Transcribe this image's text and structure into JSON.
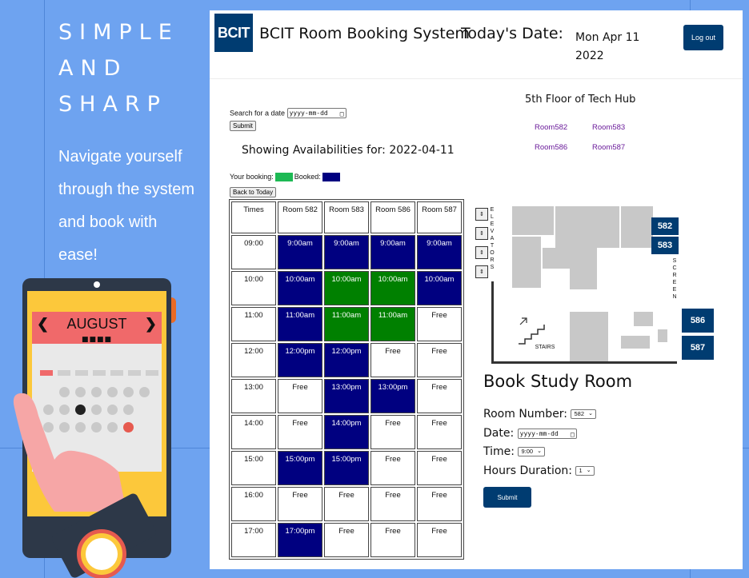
{
  "hero": {
    "title_lines": [
      "SIMPLE",
      "AND",
      "SHARP"
    ],
    "subtitle_lines": [
      "Navigate yourself",
      "through the system",
      "and book with",
      "ease!"
    ],
    "calendar_month": "AUGUST"
  },
  "header": {
    "logo": "BCIT",
    "title": "BCIT Room Booking System",
    "date_label": "Today's Date:",
    "date_line1": "Mon Apr 11",
    "date_line2": "2022",
    "logout_label": "Log out"
  },
  "search": {
    "label": "Search for a date",
    "placeholder": "yyyy-mm-dd",
    "submit_label": "Submit"
  },
  "showing": "Showing Availabilities for: 2022-04-11",
  "legend": {
    "your_booking": "Your booking:",
    "booked": "Booked:",
    "your_color": "#1db954",
    "booked_color": "#000080"
  },
  "back_to_today": "Back to Today",
  "timetable": {
    "headers": [
      "Times",
      "Room 582",
      "Room 583",
      "Room 586",
      "Room 587"
    ],
    "rows": [
      {
        "time": "09:00",
        "cells": [
          {
            "t": "9:00am",
            "s": "booked"
          },
          {
            "t": "9:00am",
            "s": "booked"
          },
          {
            "t": "9:00am",
            "s": "booked"
          },
          {
            "t": "9:00am",
            "s": "booked"
          }
        ]
      },
      {
        "time": "10:00",
        "cells": [
          {
            "t": "10:00am",
            "s": "booked"
          },
          {
            "t": "10:00am",
            "s": "mine"
          },
          {
            "t": "10:00am",
            "s": "mine"
          },
          {
            "t": "10:00am",
            "s": "booked"
          }
        ]
      },
      {
        "time": "11:00",
        "cells": [
          {
            "t": "11:00am",
            "s": "booked"
          },
          {
            "t": "11:00am",
            "s": "mine"
          },
          {
            "t": "11:00am",
            "s": "mine"
          },
          {
            "t": "Free",
            "s": "free"
          }
        ]
      },
      {
        "time": "12:00",
        "cells": [
          {
            "t": "12:00pm",
            "s": "booked"
          },
          {
            "t": "12:00pm",
            "s": "booked"
          },
          {
            "t": "Free",
            "s": "free"
          },
          {
            "t": "Free",
            "s": "free"
          }
        ]
      },
      {
        "time": "13:00",
        "cells": [
          {
            "t": "Free",
            "s": "free"
          },
          {
            "t": "13:00pm",
            "s": "booked"
          },
          {
            "t": "13:00pm",
            "s": "booked"
          },
          {
            "t": "Free",
            "s": "free"
          }
        ]
      },
      {
        "time": "14:00",
        "cells": [
          {
            "t": "Free",
            "s": "free"
          },
          {
            "t": "14:00pm",
            "s": "booked"
          },
          {
            "t": "Free",
            "s": "free"
          },
          {
            "t": "Free",
            "s": "free"
          }
        ]
      },
      {
        "time": "15:00",
        "cells": [
          {
            "t": "15:00pm",
            "s": "booked"
          },
          {
            "t": "15:00pm",
            "s": "booked"
          },
          {
            "t": "Free",
            "s": "free"
          },
          {
            "t": "Free",
            "s": "free"
          }
        ]
      },
      {
        "time": "16:00",
        "cells": [
          {
            "t": "Free",
            "s": "free"
          },
          {
            "t": "Free",
            "s": "free"
          },
          {
            "t": "Free",
            "s": "free"
          },
          {
            "t": "Free",
            "s": "free"
          }
        ]
      },
      {
        "time": "17:00",
        "cells": [
          {
            "t": "17:00pm",
            "s": "booked"
          },
          {
            "t": "Free",
            "s": "free"
          },
          {
            "t": "Free",
            "s": "free"
          },
          {
            "t": "Free",
            "s": "free"
          }
        ]
      }
    ]
  },
  "floor": {
    "title": "5th Floor of Tech Hub",
    "links": [
      "Room582",
      "Room583",
      "Room586",
      "Room587"
    ],
    "map_rooms": [
      "582",
      "583",
      "586",
      "587"
    ],
    "elevators_text": "ELEVATORS",
    "screen_text": "SCREEN",
    "stairs_text": "STAIRS"
  },
  "booking_form": {
    "title": "Book Study Room",
    "room_label": "Room Number:",
    "room_value": "582",
    "date_label": "Date:",
    "date_placeholder": "yyyy-mm-dd",
    "time_label": "Time:",
    "time_value": "9:00",
    "hours_label": "Hours Duration:",
    "hours_value": "1",
    "submit_label": "Submit"
  }
}
